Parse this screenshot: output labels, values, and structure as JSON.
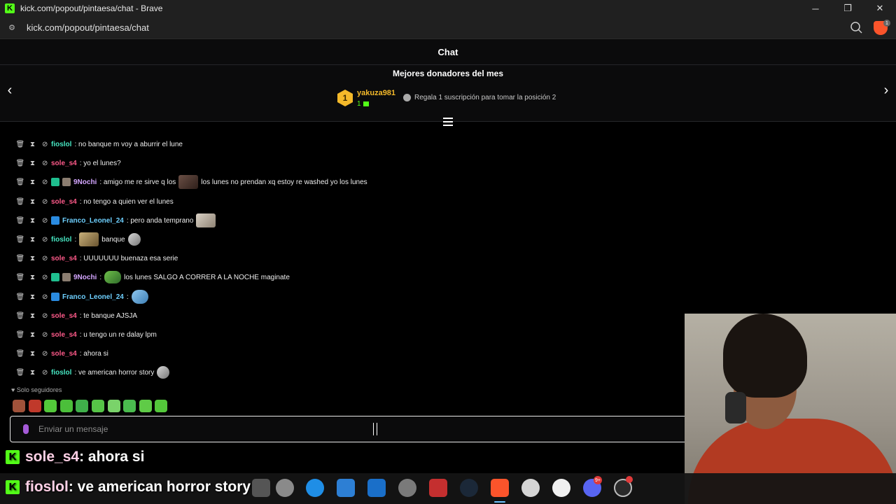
{
  "window": {
    "title": "kick.com/popout/pintaesa/chat - Brave",
    "url": "kick.com/popout/pintaesa/chat",
    "minimize": "─",
    "maximize": "❐",
    "close": "✕"
  },
  "chat": {
    "header": "Chat",
    "donors_title": "Mejores donadores del mes",
    "top_donor": {
      "rank": "1",
      "name": "yakuza981",
      "count": "1"
    },
    "cta": "Regala 1 suscripción para tomar la posición 2",
    "messages": [
      {
        "user": "fioslol",
        "text": ": no banque m voy a aburrir el lune"
      },
      {
        "user": "sole_s4",
        "text": ": yo el lunes?"
      },
      {
        "user": "9Nochi",
        "text": ": amigo me re sirve q los",
        "text2": "los lunes no prendan xq estoy re washed yo los lunes"
      },
      {
        "user": "sole_s4",
        "text": ": no tengo a quien ver el lunes"
      },
      {
        "user": "Franco_Leonel_24",
        "text": ": pero anda temprano"
      },
      {
        "user": "fioslol",
        "text": ":",
        "text2": "banque"
      },
      {
        "user": "sole_s4",
        "text": ": UUUUUUU buenaza esa serie"
      },
      {
        "user": "9Nochi",
        "text": ":",
        "text2": "los lunes SALGO A CORRER A LA NOCHE maginate"
      },
      {
        "user": "Franco_Leonel_24",
        "text": ":"
      },
      {
        "user": "sole_s4",
        "text": ": te banque AJSJA"
      },
      {
        "user": "sole_s4",
        "text": ": u tengo un re dalay lpm"
      },
      {
        "user": "sole_s4",
        "text": ": ahora si"
      },
      {
        "user": "fioslol",
        "text": ": ve american horror story"
      }
    ],
    "followers_only": "Solo seguidores",
    "input_placeholder": "Enviar un mensaje"
  },
  "overlay": {
    "line1_user": "sole_s4",
    "line1_text": ": ahora si",
    "line2_user": "fioslol",
    "line2_text": ": ve american horror story"
  },
  "taskbar": {
    "discord_badge": "9+"
  },
  "colors": {
    "kick_green": "#53fc18",
    "donor_gold": "#f4b92a",
    "user_pink": "#ff5a8a",
    "user_teal": "#47e6c2"
  }
}
